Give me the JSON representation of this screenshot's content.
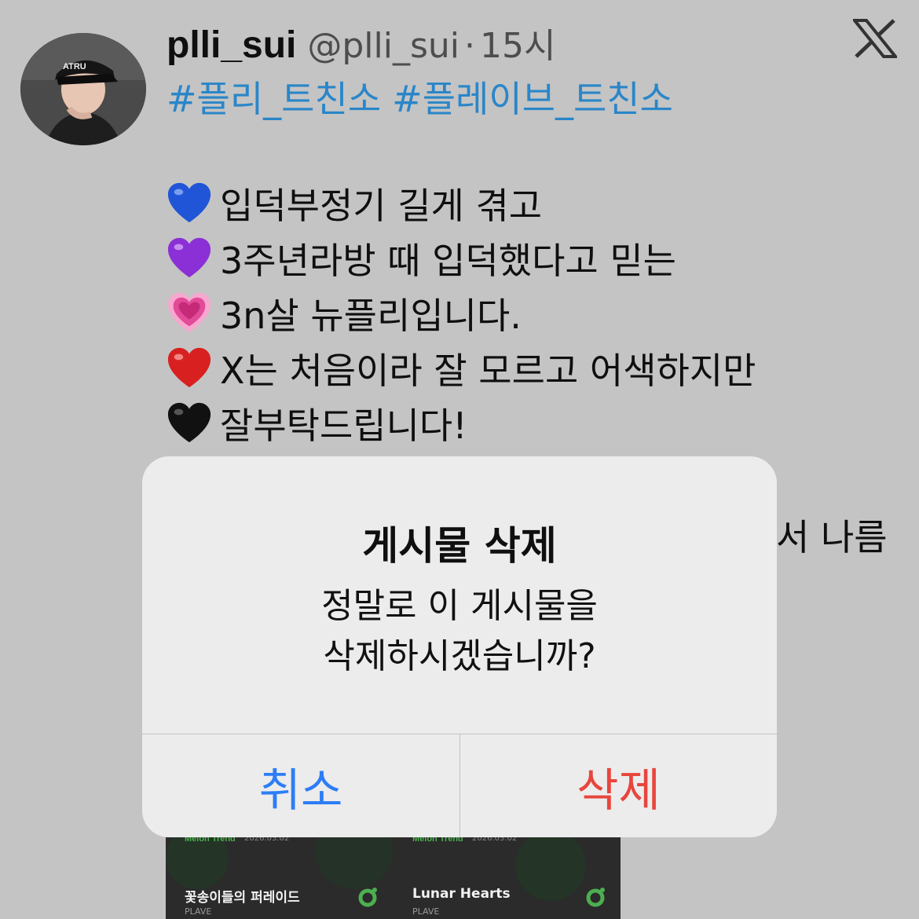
{
  "tweet": {
    "display_name": "plli_sui",
    "handle": "@plli_sui",
    "separator": "·",
    "time": "15시",
    "hashtags": [
      "#플리_트친소",
      "#플레이브_트친소"
    ],
    "lines": [
      {
        "heart": "blue-heart",
        "color": "#1f55d6",
        "text": "입덕부정기 길게 겪고"
      },
      {
        "heart": "purple-heart",
        "color": "#8b2fd6",
        "text": "3주년라방 때 입덕했다고 믿는"
      },
      {
        "heart": "pink-heart",
        "color": "#e24b98",
        "text": "3n살 뉴플리입니다."
      },
      {
        "heart": "red-heart",
        "color": "#d92020",
        "text": "X는 처음이라 잘 모르고 어색하지만"
      },
      {
        "heart": "black-heart",
        "color": "#111111",
        "text": "잘부탁드립니다!"
      }
    ],
    "partial_text": "서 나름",
    "avatar_cap_text": "ATRU"
  },
  "media": {
    "cards": [
      {
        "brand": "Melon Trend",
        "date": "2026.03.02",
        "title": "꽃송이들의 퍼레이드",
        "artist": "PLAVE"
      },
      {
        "brand": "Melon Trend",
        "date": "2026.03.02",
        "title": "Lunar Hearts",
        "artist": "PLAVE"
      }
    ]
  },
  "dialog": {
    "title": "게시물 삭제",
    "message_line1": "정말로 이 게시물을",
    "message_line2": "삭제하시겠습니까?",
    "cancel_label": "취소",
    "delete_label": "삭제"
  },
  "colors": {
    "background": "#c4c4c4",
    "hashtag": "#2a86c9",
    "cancel": "#2d7df6",
    "delete": "#e8453c"
  }
}
